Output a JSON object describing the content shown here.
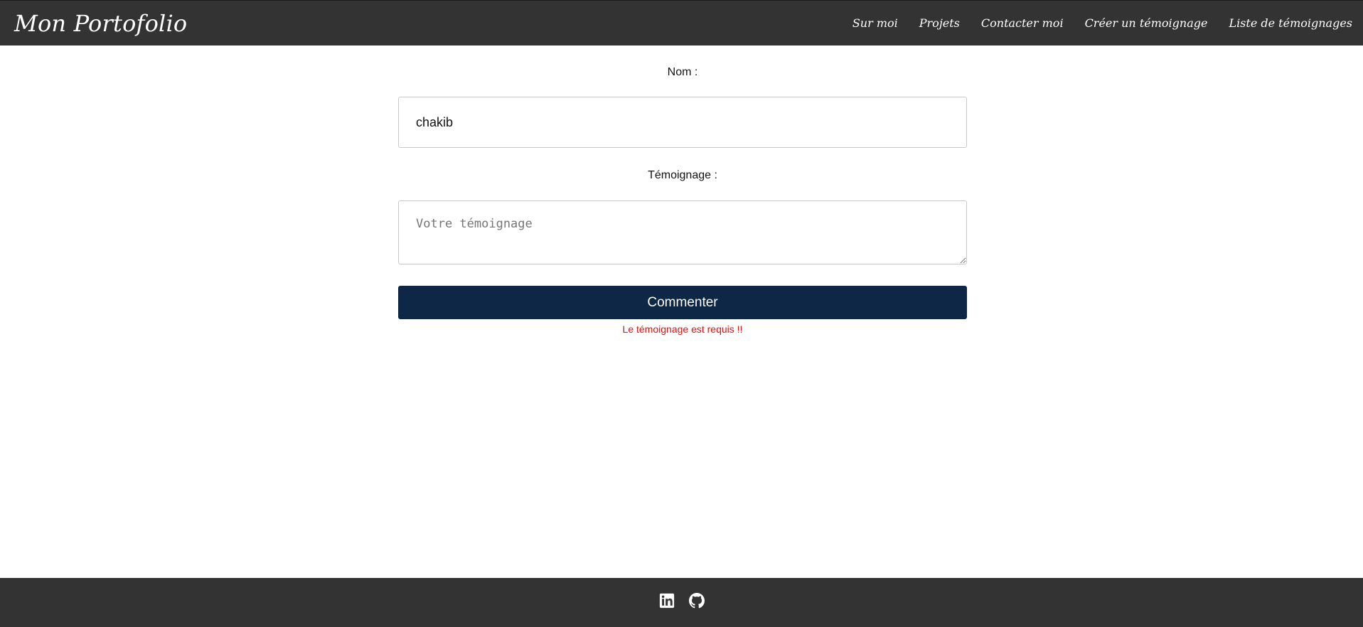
{
  "header": {
    "brand": "Mon Portofolio",
    "nav": [
      {
        "label": "Sur moi"
      },
      {
        "label": "Projets"
      },
      {
        "label": "Contacter moi"
      },
      {
        "label": "Créer un témoignage"
      },
      {
        "label": "Liste de témoignages"
      }
    ]
  },
  "form": {
    "name_label": "Nom :",
    "name_value": "chakib",
    "testimony_label": "Témoignage :",
    "testimony_placeholder": "Votre témoignage",
    "submit_label": "Commenter",
    "error_message": "Le témoignage est requis !!"
  },
  "footer": {
    "icons": [
      {
        "name": "linkedin-icon"
      },
      {
        "name": "github-icon"
      }
    ]
  },
  "colors": {
    "header_bg": "#333333",
    "footer_bg": "#333333",
    "button_bg": "#0e2746",
    "error": "#e01010"
  }
}
